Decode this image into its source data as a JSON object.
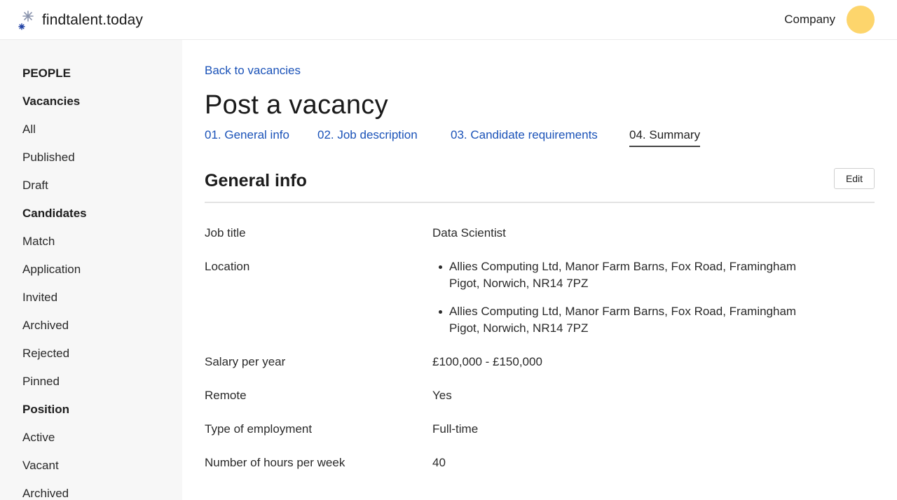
{
  "brand": {
    "name": "findtalent.today"
  },
  "header": {
    "company_label": "Company",
    "avatar_color": "#fdd56c"
  },
  "sidebar": {
    "items": [
      {
        "label": "PEOPLE",
        "heading": true
      },
      {
        "label": "Vacancies",
        "heading": true
      },
      {
        "label": "All",
        "heading": false
      },
      {
        "label": "Published",
        "heading": false
      },
      {
        "label": "Draft",
        "heading": false
      },
      {
        "label": "Candidates",
        "heading": true
      },
      {
        "label": "Match",
        "heading": false
      },
      {
        "label": "Application",
        "heading": false
      },
      {
        "label": "Invited",
        "heading": false
      },
      {
        "label": "Archived",
        "heading": false
      },
      {
        "label": "Rejected",
        "heading": false
      },
      {
        "label": "Pinned",
        "heading": false
      },
      {
        "label": "Position",
        "heading": true
      },
      {
        "label": "Active",
        "heading": false
      },
      {
        "label": "Vacant",
        "heading": false
      },
      {
        "label": "Archived",
        "heading": false
      }
    ]
  },
  "main": {
    "back_link": "Back to vacancies",
    "title": "Post a vacancy",
    "steps": [
      {
        "label": "01. General info",
        "active": false
      },
      {
        "label": "02. Job description",
        "active": false
      },
      {
        "label": "03. Candidate requirements",
        "active": false
      },
      {
        "label": "04. Summary",
        "active": true
      }
    ],
    "section": {
      "title": "General info",
      "edit_label": "Edit",
      "fields": {
        "job_title": {
          "label": "Job title",
          "value": "Data Scientist"
        },
        "location": {
          "label": "Location",
          "values": [
            "Allies Computing Ltd, Manor Farm Barns, Fox Road, Framingham Pigot, Norwich, NR14 7PZ",
            "Allies Computing Ltd, Manor Farm Barns, Fox Road, Framingham Pigot, Norwich, NR14 7PZ"
          ]
        },
        "salary": {
          "label": "Salary per year",
          "value": "£100,000 - £150,000"
        },
        "remote": {
          "label": "Remote",
          "value": "Yes"
        },
        "employment_type": {
          "label": "Type of employment",
          "value": "Full-time"
        },
        "hours": {
          "label": "Number of hours per week",
          "value": "40"
        }
      }
    }
  },
  "colors": {
    "link": "#1a52b8",
    "sidebar_bg": "#f7f7f7",
    "logo_blue": "#1d3fa3",
    "logo_grey": "#8a94ad"
  }
}
